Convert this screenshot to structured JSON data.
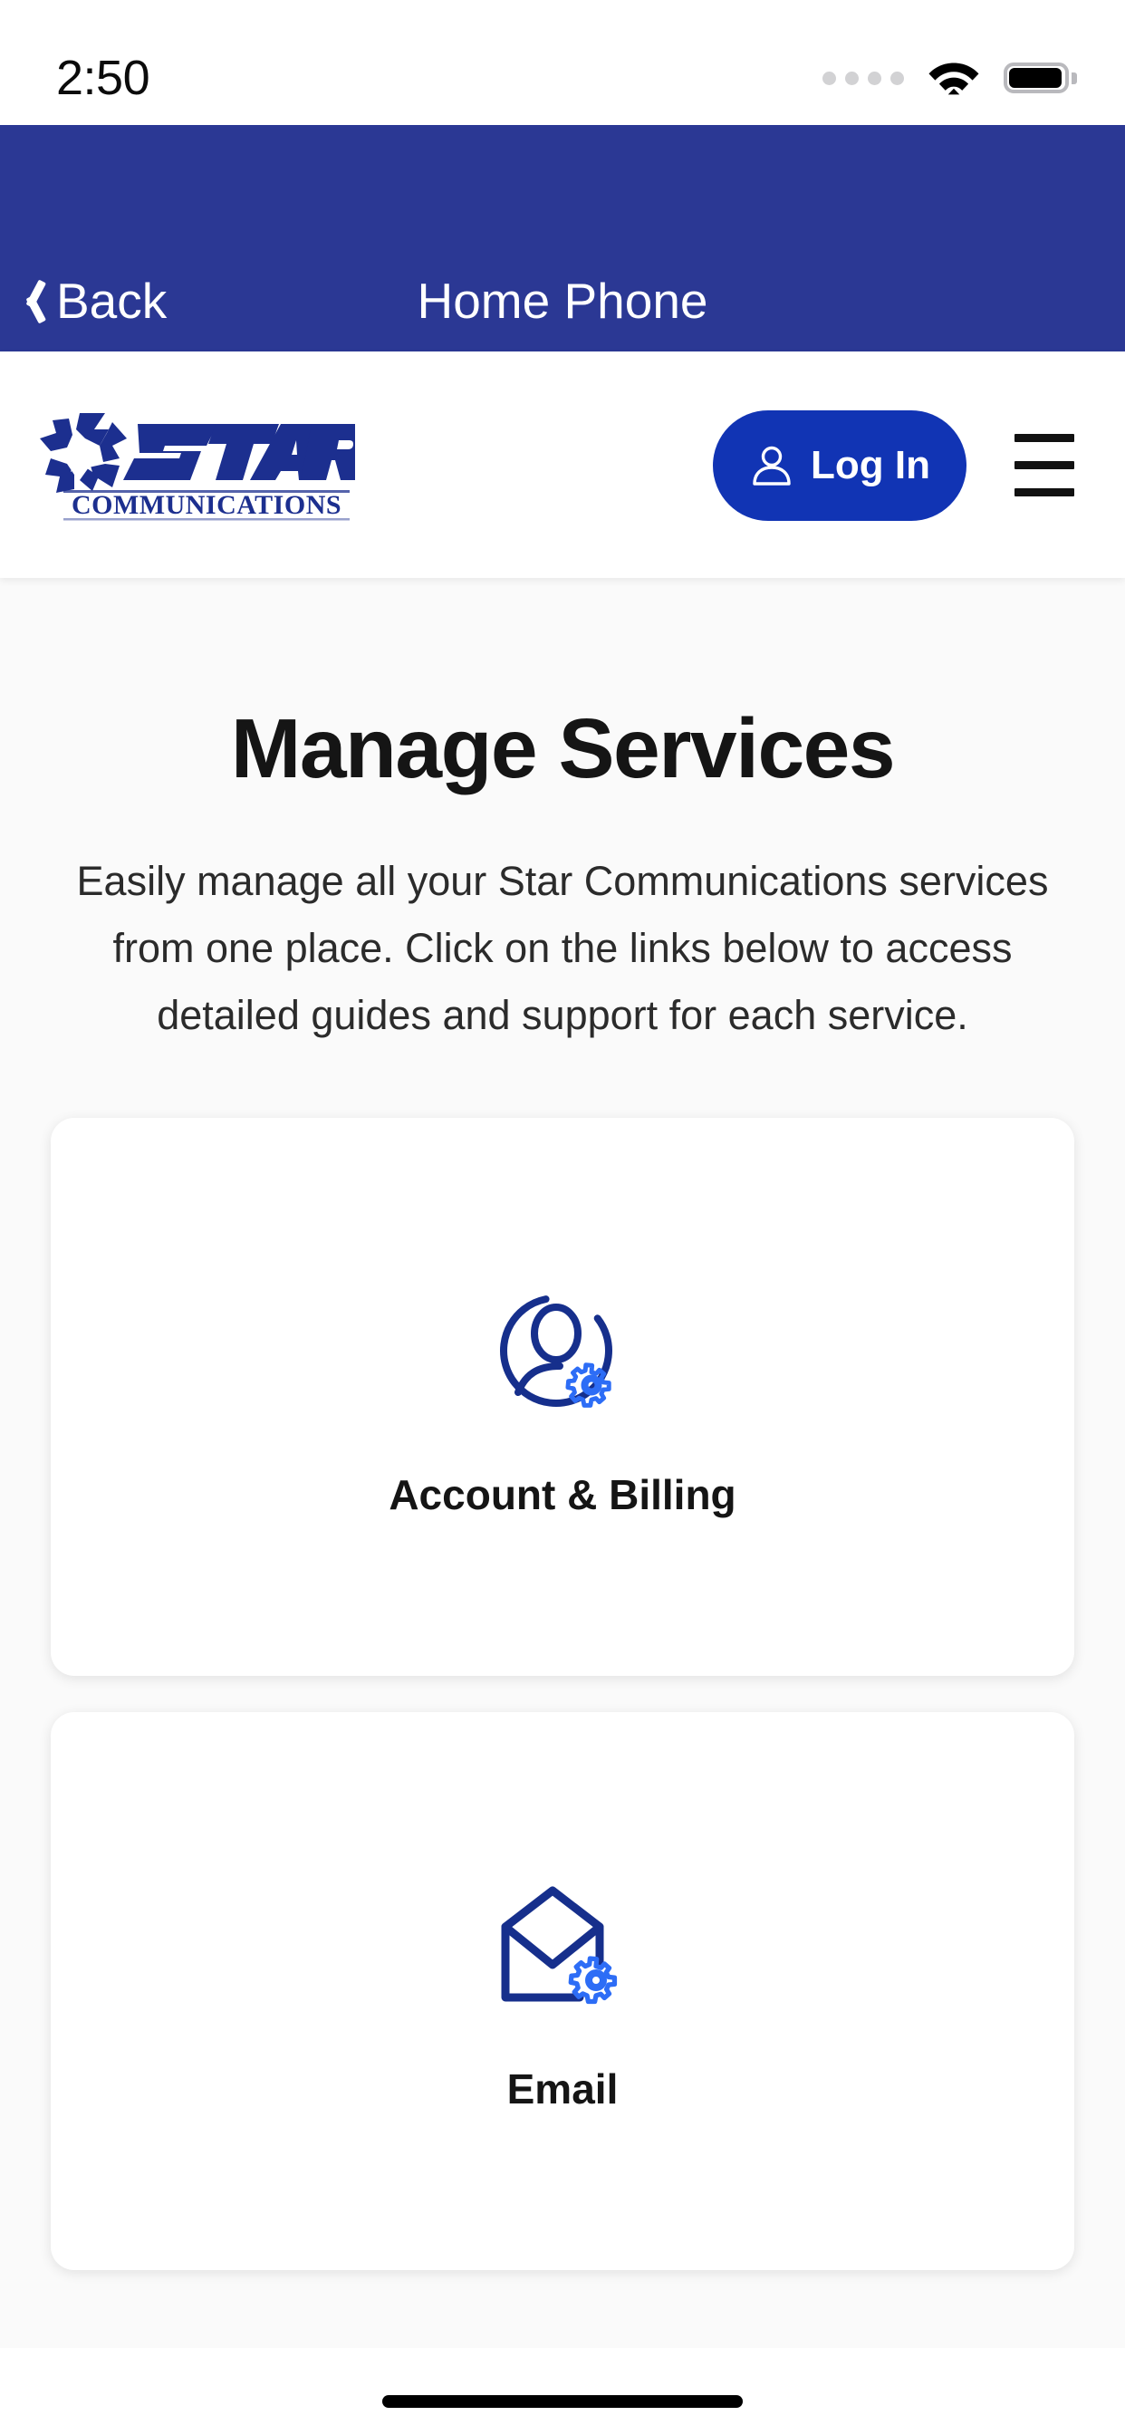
{
  "status_bar": {
    "time": "2:50",
    "signal_icon": "signal-dots-icon",
    "wifi_icon": "wifi-icon",
    "battery_icon": "battery-full-icon"
  },
  "nav_bar": {
    "back_label": "Back",
    "back_icon": "chevron-left-icon",
    "title": "Home Phone",
    "background_color": "#2b3894"
  },
  "site_header": {
    "logo": {
      "mark": "star-pinwheel-icon",
      "wordmark": "STAR",
      "subwordmark": "COMMUNICATIONS",
      "color": "#1c2f8f"
    },
    "login": {
      "label": "Log In",
      "icon": "user-icon",
      "background_color": "#1134b4"
    },
    "menu": {
      "icon": "hamburger-menu-icon"
    }
  },
  "main": {
    "title": "Manage Services",
    "description": "Easily manage all your Star Communications services from one place. Click on the links below to access detailed guides and support for each service.",
    "cards": [
      {
        "label": "Account & Billing",
        "icon": "account-settings-icon",
        "icon_color": "#162f8c",
        "accent_color": "#2d6df6"
      },
      {
        "label": "Email",
        "icon": "email-settings-icon",
        "icon_color": "#162f8c",
        "accent_color": "#2d6df6"
      }
    ]
  },
  "colors": {
    "page_background": "#fafafa",
    "nav_blue": "#2b3894",
    "brand_blue": "#1134b4",
    "text_dark": "#151515"
  }
}
